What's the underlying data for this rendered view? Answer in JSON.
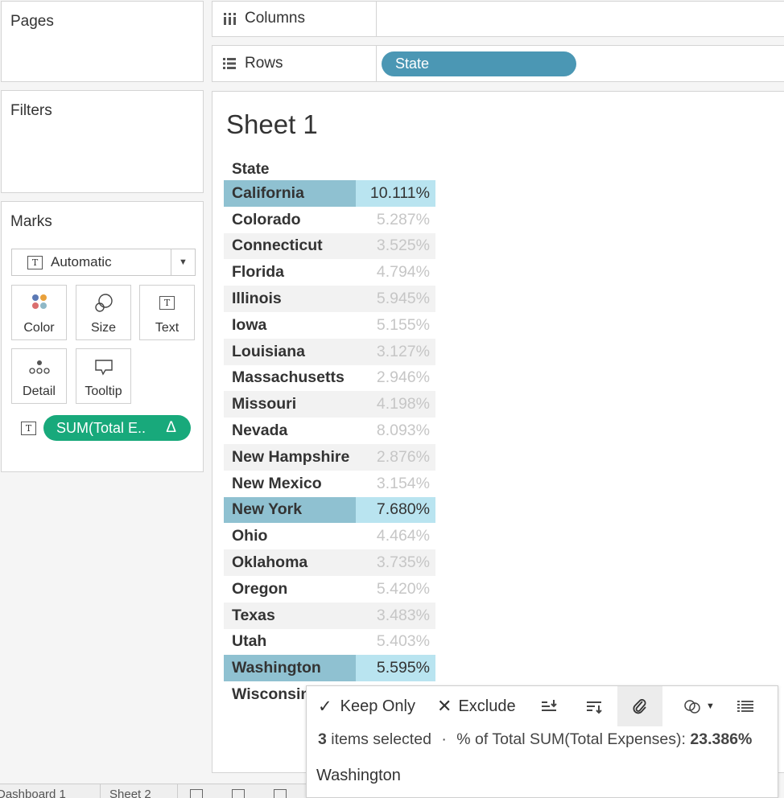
{
  "pages": {
    "title": "Pages"
  },
  "filters": {
    "title": "Filters"
  },
  "columns_shelf": {
    "label": "Columns",
    "icon": "columns-icon"
  },
  "rows_shelf": {
    "label": "Rows",
    "icon": "rows-icon",
    "pill": "State",
    "pill_color": "#4b97b4"
  },
  "marks": {
    "title": "Marks",
    "mark_type": "Automatic",
    "cards": [
      {
        "label": "Color",
        "icon": "color-icon"
      },
      {
        "label": "Size",
        "icon": "size-icon"
      },
      {
        "label": "Text",
        "icon": "text-icon"
      },
      {
        "label": "Detail",
        "icon": "detail-icon"
      },
      {
        "label": "Tooltip",
        "icon": "tooltip-icon"
      }
    ],
    "measure_pill": "SUM(Total E..",
    "measure_pill_delta": "Δ",
    "measure_pill_color": "#18a97b"
  },
  "sheet": {
    "title": "Sheet 1",
    "column_header": "State",
    "rows": [
      {
        "state": "California",
        "pct": "10.111%",
        "selected": true
      },
      {
        "state": "Colorado",
        "pct": "5.287%",
        "selected": false
      },
      {
        "state": "Connecticut",
        "pct": "3.525%",
        "selected": false
      },
      {
        "state": "Florida",
        "pct": "4.794%",
        "selected": false
      },
      {
        "state": "Illinois",
        "pct": "5.945%",
        "selected": false
      },
      {
        "state": "Iowa",
        "pct": "5.155%",
        "selected": false
      },
      {
        "state": "Louisiana",
        "pct": "3.127%",
        "selected": false
      },
      {
        "state": "Massachusetts",
        "pct": "2.946%",
        "selected": false
      },
      {
        "state": "Missouri",
        "pct": "4.198%",
        "selected": false
      },
      {
        "state": "Nevada",
        "pct": "8.093%",
        "selected": false
      },
      {
        "state": "New Hampshire",
        "pct": "2.876%",
        "selected": false
      },
      {
        "state": "New Mexico",
        "pct": "3.154%",
        "selected": false
      },
      {
        "state": "New York",
        "pct": "7.680%",
        "selected": true
      },
      {
        "state": "Ohio",
        "pct": "4.464%",
        "selected": false
      },
      {
        "state": "Oklahoma",
        "pct": "3.735%",
        "selected": false
      },
      {
        "state": "Oregon",
        "pct": "5.420%",
        "selected": false
      },
      {
        "state": "Texas",
        "pct": "3.483%",
        "selected": false
      },
      {
        "state": "Utah",
        "pct": "5.403%",
        "selected": false
      },
      {
        "state": "Washington",
        "pct": "5.595%",
        "selected": true
      },
      {
        "state": "Wisconsin",
        "pct": "",
        "selected": false
      }
    ]
  },
  "popup": {
    "keep_only": "Keep Only",
    "exclude": "Exclude",
    "count": "3",
    "items_selected": "items selected",
    "separator": "·",
    "summary_label": "% of Total SUM(Total Expenses):",
    "summary_value": "23.386%",
    "hover_item": "Washington"
  },
  "bottom_tabs": {
    "tab1": "Dashboard 1",
    "tab2": "Sheet 2"
  }
}
